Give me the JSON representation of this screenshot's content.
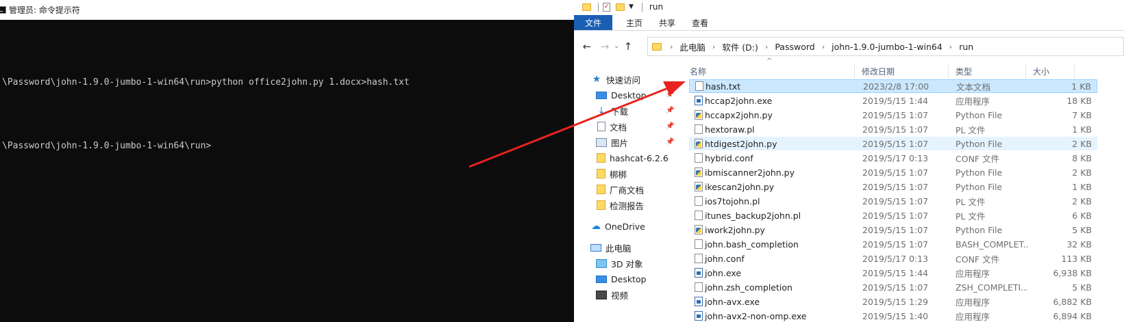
{
  "console": {
    "title": "管理员: 命令提示符",
    "lines": [
      "\\Password\\john-1.9.0-jumbo-1-win64\\run>python office2john.py 1.docx>hash.txt",
      "\\Password\\john-1.9.0-jumbo-1-win64\\run>"
    ]
  },
  "explorer": {
    "window_title": "run",
    "tabs": [
      "文件",
      "主页",
      "共享",
      "查看"
    ],
    "breadcrumb": [
      "此电脑",
      "软件 (D:)",
      "Password",
      "john-1.9.0-jumbo-1-win64",
      "run"
    ],
    "nav_pane": {
      "quick_access": "快速访问",
      "items": [
        "Desktop",
        "下载",
        "文档",
        "图片",
        "hashcat-6.2.6",
        "梆梆",
        "厂商文档",
        "检测报告"
      ],
      "onedrive": "OneDrive",
      "this_pc": "此电脑",
      "pc_items": [
        "3D 对象",
        "Desktop",
        "视频"
      ]
    },
    "columns": {
      "name": "名称",
      "date": "修改日期",
      "type": "类型",
      "size": "大小"
    },
    "files": [
      {
        "name": "hash.txt",
        "date": "2023/2/8 17:00",
        "type": "文本文档",
        "size": "1 KB",
        "icon": "doc"
      },
      {
        "name": "hccap2john.exe",
        "date": "2019/5/15 1:44",
        "type": "应用程序",
        "size": "18 KB",
        "icon": "exe"
      },
      {
        "name": "hccapx2john.py",
        "date": "2019/5/15 1:07",
        "type": "Python File",
        "size": "7 KB",
        "icon": "py"
      },
      {
        "name": "hextoraw.pl",
        "date": "2019/5/15 1:07",
        "type": "PL 文件",
        "size": "1 KB",
        "icon": "doc"
      },
      {
        "name": "htdigest2john.py",
        "date": "2019/5/15 1:07",
        "type": "Python File",
        "size": "2 KB",
        "icon": "py"
      },
      {
        "name": "hybrid.conf",
        "date": "2019/5/17 0:13",
        "type": "CONF 文件",
        "size": "8 KB",
        "icon": "doc"
      },
      {
        "name": "ibmiscanner2john.py",
        "date": "2019/5/15 1:07",
        "type": "Python File",
        "size": "2 KB",
        "icon": "py"
      },
      {
        "name": "ikescan2john.py",
        "date": "2019/5/15 1:07",
        "type": "Python File",
        "size": "1 KB",
        "icon": "py"
      },
      {
        "name": "ios7tojohn.pl",
        "date": "2019/5/15 1:07",
        "type": "PL 文件",
        "size": "2 KB",
        "icon": "doc"
      },
      {
        "name": "itunes_backup2john.pl",
        "date": "2019/5/15 1:07",
        "type": "PL 文件",
        "size": "6 KB",
        "icon": "doc"
      },
      {
        "name": "iwork2john.py",
        "date": "2019/5/15 1:07",
        "type": "Python File",
        "size": "5 KB",
        "icon": "py"
      },
      {
        "name": "john.bash_completion",
        "date": "2019/5/15 1:07",
        "type": "BASH_COMPLET...",
        "size": "32 KB",
        "icon": "doc"
      },
      {
        "name": "john.conf",
        "date": "2019/5/17 0:13",
        "type": "CONF 文件",
        "size": "113 KB",
        "icon": "doc"
      },
      {
        "name": "john.exe",
        "date": "2019/5/15 1:44",
        "type": "应用程序",
        "size": "6,938 KB",
        "icon": "exe"
      },
      {
        "name": "john.zsh_completion",
        "date": "2019/5/15 1:07",
        "type": "ZSH_COMPLETI...",
        "size": "5 KB",
        "icon": "doc"
      },
      {
        "name": "john-avx.exe",
        "date": "2019/5/15 1:29",
        "type": "应用程序",
        "size": "6,882 KB",
        "icon": "exe"
      },
      {
        "name": "john-avx2-non-omp.exe",
        "date": "2019/5/15 1:40",
        "type": "应用程序",
        "size": "6,894 KB",
        "icon": "exe"
      }
    ]
  },
  "colors": {
    "console_bg": "#0c0c0c",
    "file_tab": "#1a5fb4",
    "selection": "#cce8ff",
    "annotation_arrow": "#e8231f"
  }
}
